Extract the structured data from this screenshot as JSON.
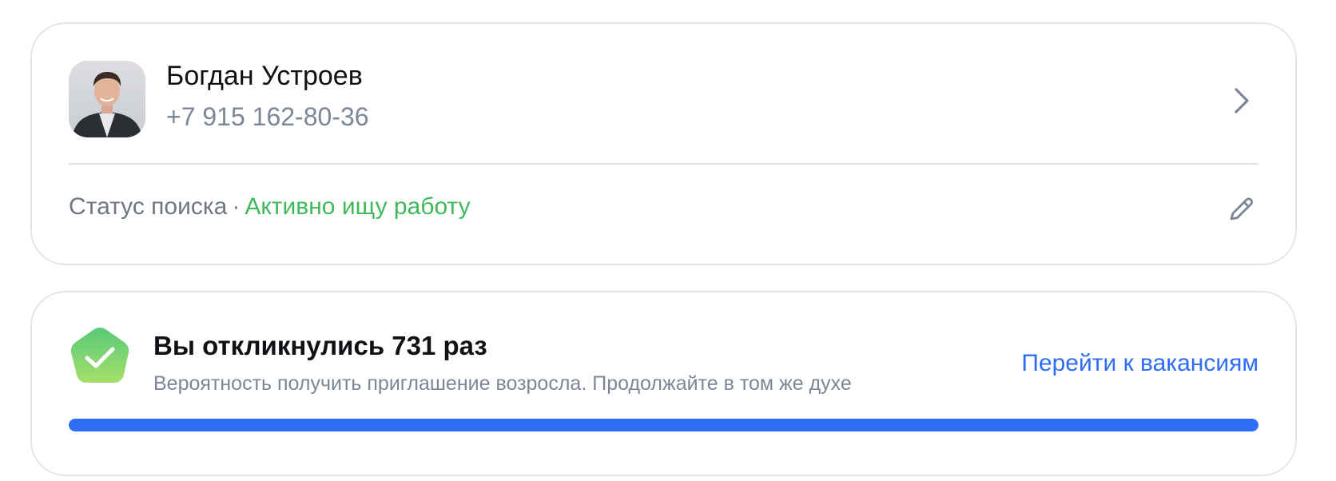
{
  "profile": {
    "name": "Богдан Устроев",
    "phone": "+7 915 162-80-36",
    "avatar_icon": "user-photo",
    "open_icon": "chevron-right-icon",
    "status": {
      "label": "Статус поиска",
      "separator": "·",
      "value": "Активно ищу работу",
      "value_color": "#3fb95a",
      "edit_icon": "pencil-icon"
    }
  },
  "responses": {
    "badge_icon": "check-badge-icon",
    "title": "Вы откликнулись 731 раз",
    "subtitle": "Вероятность получить приглашение возросла. Продолжайте в том же духе",
    "link_label": "Перейти к вакансиям",
    "link_color": "#2f6df6",
    "progress": 1.0
  }
}
